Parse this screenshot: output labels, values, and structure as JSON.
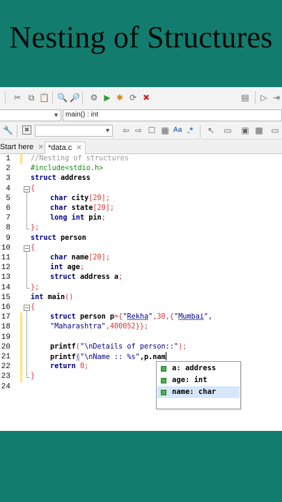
{
  "title": "Nesting of Structures",
  "toolbar": {
    "function_combo": "main() : int"
  },
  "tabs": [
    {
      "label": "Start here",
      "active": false
    },
    {
      "label": "*data.c",
      "active": true
    }
  ],
  "line_numbers": [
    "1",
    "2",
    "3",
    "4",
    "5",
    "6",
    "7",
    "8",
    "9",
    "10",
    "11",
    "12",
    "13",
    "14",
    "15",
    "16",
    "17",
    "18",
    "19",
    "20",
    "21",
    "22",
    "23",
    "24"
  ],
  "code": {
    "l1": "//Nesting of structures",
    "l2": "#include<stdio.h>",
    "l3a": "struct",
    "l3b": " address",
    "l4": "{",
    "l5a": "char",
    "l5b": " city",
    "l5c": "[",
    "l5d": "20",
    "l5e": "];",
    "l6a": "char",
    "l6b": " state",
    "l6c": "[",
    "l6d": "20",
    "l6e": "];",
    "l7a": "long",
    "l7b": " int",
    "l7c": " pin",
    "l7d": ";",
    "l8": "};",
    "l9a": "struct",
    "l9b": " person",
    "l10": "{",
    "l11a": "char",
    "l11b": " name",
    "l11c": "[",
    "l11d": "20",
    "l11e": "];",
    "l12a": "int",
    "l12b": " age",
    "l12c": ";",
    "l13a": "struct",
    "l13b": " address a",
    "l13c": ";",
    "l14": "};",
    "l15a": "int",
    "l15b": " main",
    "l15c": "()",
    "l16": "{",
    "l17a": "struct",
    "l17b": " person p",
    "l17c": "={",
    "l17d": "\"",
    "l17e": "Rekha",
    "l17f": "\"",
    "l17g": ",",
    "l17h": "30",
    "l17i": ",{",
    "l17j": "\"",
    "l17k": "Mumbai",
    "l17l": "\",",
    "l18a": "\"Maharashtra\"",
    "l18b": ",",
    "l18c": "400052",
    "l18d": "}};",
    "l20a": "printf",
    "l20b": "(",
    "l20c": "\"\\nDetails of person::\"",
    "l20d": ");",
    "l21a": "printf",
    "l21b": "(",
    "l21c": "\"\\nName :: %s\"",
    "l21d": ",p.nam",
    "l22a": "return",
    "l22b": " 0",
    "l22c": ";",
    "l23": "}"
  },
  "autocomplete": [
    {
      "label": "a: address",
      "selected": false
    },
    {
      "label": "age: int",
      "selected": false
    },
    {
      "label": "name: char",
      "selected": true
    }
  ]
}
